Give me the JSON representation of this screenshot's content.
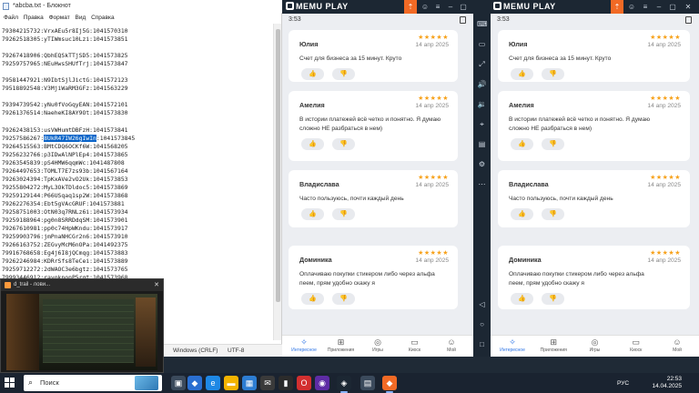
{
  "notepad": {
    "title": "*abcba.txt - Блокнот",
    "menu": [
      "Файл",
      "Правка",
      "Формат",
      "Вид",
      "Справка"
    ],
    "lines": [
      "79304215732:VrxAEu5r8Ij5G:1041570310",
      "79262518305:yTIWmsuc10Lzi:1041573851",
      "",
      "79267418906:QbhEQSkTTjSD5:1041573825",
      "79259757965:NEuHwsSHUfTrj:1041573847",
      "",
      "79581447921:N9IbtSjlJictG:1041572123",
      "79518892548:V3MjiWaRM3GFz:1041563229",
      "",
      "79394739542:yNu0fVoGqyEAN:1041572101",
      "79261376514:NaeheKI8AY9Ot:1041573830",
      "",
      "79262438153:usVWHumtDBFzH:1041573841",
      "79257586267:",
      "79264515563:BMtCDQ6OCKf6W:1041568205",
      "79256232766:p3IDwAlNPlEp4:1041573865",
      "79263545839:pS4HMW6qqmWc:1041487808",
      "79264497653:TOMLT7E7zs93b:1041567164",
      "79263024394:TpKxAVe2vO2Uk:1041573853",
      "79255804272:MyL3OkTDldoc5:1041573869",
      "79259129144:P66USqaq1sp2W:1041573868",
      "79262276354:Ebt5gVAcGRUF:1041573881",
      "79258751003:OtN03q7RNLz6i:1041573934",
      "79259188964:pg0n8SRRDdqSM:1041573901",
      "79267610981:pp0c74HpWKndu:1041573917",
      "79259903796:jmPnaNHCGr2n6:1041573910",
      "79266163752:ZEGvyMcM6nOPa:1041492375",
      "79916768658:Eg4j6I8jQCmqg:1041573883",
      "79262246984:KDRrSfs8TeCei:1041573889",
      "79259712272:2dWAOC3e6bgtz:1041573765",
      "79993446912:ravoknonP5rgt:1041573968"
    ],
    "selected_segment": "8UkR47IW26gIwIn",
    "selected_tail": ":1041573845",
    "status_encoding": "Windows (CRLF)",
    "status_charset": "UTF-8"
  },
  "preview": {
    "title": "d_trail - лови..."
  },
  "memu_left": {
    "logo": "MEMU PLAY",
    "time": "3:53",
    "reviews": [
      {
        "name": "Юлия",
        "stars": "★★★★★",
        "date": "14 апр 2025",
        "lines": [
          "Счет для бизнеса за 15 минут. Круто"
        ]
      },
      {
        "name": "Амелия",
        "stars": "★★★★★",
        "date": "14 апр 2025",
        "lines": [
          "В истории платежей всё четко и понятно. Я думаю",
          "сложно НЕ разбраться в нем)"
        ]
      },
      {
        "name": "Владислава",
        "stars": "★★★★★",
        "date": "14 апр 2025",
        "lines": [
          "Часто пользуюсь, почти каждый день"
        ]
      },
      {
        "name": "Доминика",
        "stars": "★★★★★",
        "date": "14 апр 2025",
        "lines": [
          "Оплачиваю покупки стикером либо через альфа",
          "пеем, прям удобно скажу я"
        ]
      }
    ],
    "nav": [
      {
        "label": "Интересное",
        "icon": "✧"
      },
      {
        "label": "Приложения",
        "icon": "⊞"
      },
      {
        "label": "Игры",
        "icon": "◎"
      },
      {
        "label": "Киоск",
        "icon": "▭"
      },
      {
        "label": "Мой",
        "icon": "☺"
      }
    ]
  },
  "memu_right": {
    "logo": "MEMU PLAY",
    "time": "3:53",
    "reviews": [
      {
        "name": "Юлия",
        "stars": "★★★★★",
        "date": "14 апр 2025",
        "lines": [
          "Счет для бизнеса за 15 минут. Круто"
        ]
      },
      {
        "name": "Амелия",
        "stars": "★★★★★",
        "date": "14 апр 2025",
        "lines": [
          "В истории платежей всё четко и понятно. Я думаю",
          "сложно НЕ разбраться в нем)"
        ]
      },
      {
        "name": "Владислава",
        "stars": "★★★★★",
        "date": "14 апр 2025",
        "lines": [
          "Часто пользуюсь, почти каждый день"
        ]
      },
      {
        "name": "Доминика",
        "stars": "★★★★★",
        "date": "14 апр 2025",
        "lines": [
          "Оплачиваю покупки стикером либо через альфа",
          "пеем, прям удобно скажу я"
        ]
      }
    ],
    "nav": [
      {
        "label": "Интересное",
        "icon": "✧"
      },
      {
        "label": "Приложения",
        "icon": "⊞"
      },
      {
        "label": "Игры",
        "icon": "◎"
      },
      {
        "label": "Киоск",
        "icon": "▭"
      },
      {
        "label": "Мой",
        "icon": "☺"
      }
    ]
  },
  "review_buttons": {
    "like": "👍",
    "dislike": "👎"
  },
  "taskbar": {
    "search_placeholder": "Поиск",
    "lang": "РУС",
    "time": "22:53",
    "date": "14.04.2025"
  },
  "colors": {
    "accent": "#2b73e6",
    "memu_dark": "#1c2733",
    "memu_orange": "#f26a25",
    "stars": "#f7a21b",
    "selection": "#0a64c8"
  }
}
